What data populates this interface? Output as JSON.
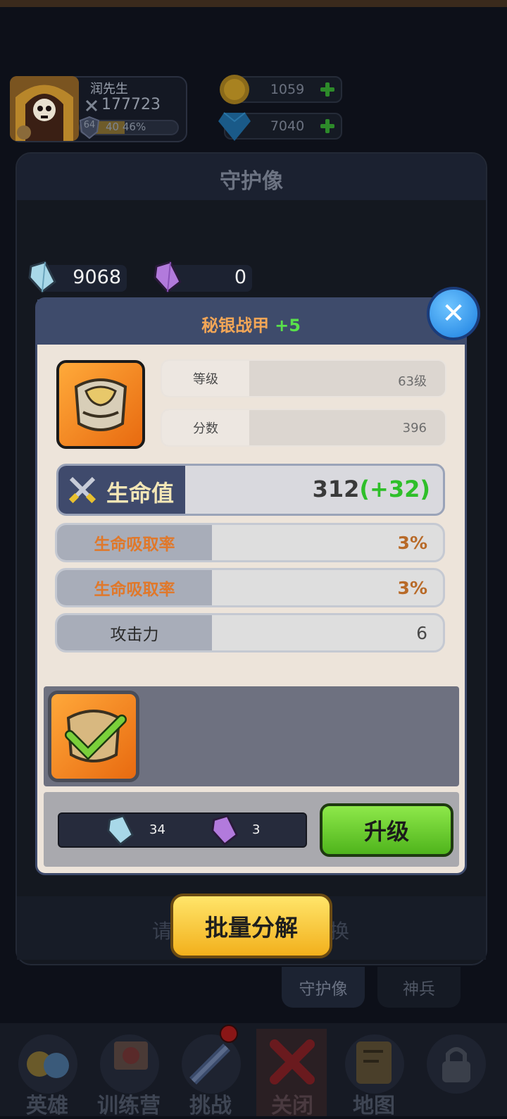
{
  "player": {
    "name": "润先生",
    "power": "177723",
    "level": "64",
    "xp_current": "40",
    "xp_percent": "46%",
    "xp_fraction": 0.46
  },
  "currencies": {
    "gold": "1059",
    "diamond": "7040"
  },
  "panel": {
    "title": "守护像",
    "resource_blue": "9068",
    "resource_purple": "0",
    "hint_left": "请",
    "hint_right": "换"
  },
  "modal": {
    "item_name": "秘银战甲",
    "item_plus": "+5",
    "stats": [
      {
        "label": "等级",
        "value": "63级"
      },
      {
        "label": "分数",
        "value": "396"
      }
    ],
    "main_attr": {
      "label": "生命值",
      "value": "312",
      "bonus": "(+32)"
    },
    "attrs": [
      {
        "label": "生命吸取率",
        "value": "3%"
      },
      {
        "label": "生命吸取率",
        "value": "3%"
      },
      {
        "label": "攻击力",
        "value": "6"
      }
    ],
    "cost_blue": "34",
    "cost_purple": "3",
    "upgrade_label": "升级"
  },
  "batch_label": "批量分解",
  "subtabs": [
    "守护像",
    "神兵"
  ],
  "nav": [
    {
      "label": "英雄",
      "icon": "heroes-icon"
    },
    {
      "label": "训练营",
      "icon": "training-camp-icon"
    },
    {
      "label": "挑战",
      "icon": "sword-challenge-icon"
    },
    {
      "label": "关闭",
      "icon": "close-x-icon"
    },
    {
      "label": "地图",
      "icon": "map-icon"
    },
    {
      "label": "",
      "icon": "lock-icon"
    }
  ],
  "colors": {
    "orange_label": "#e0782a",
    "green_bonus": "#2fbf2a",
    "accent_blue": "#1b7fe0"
  }
}
